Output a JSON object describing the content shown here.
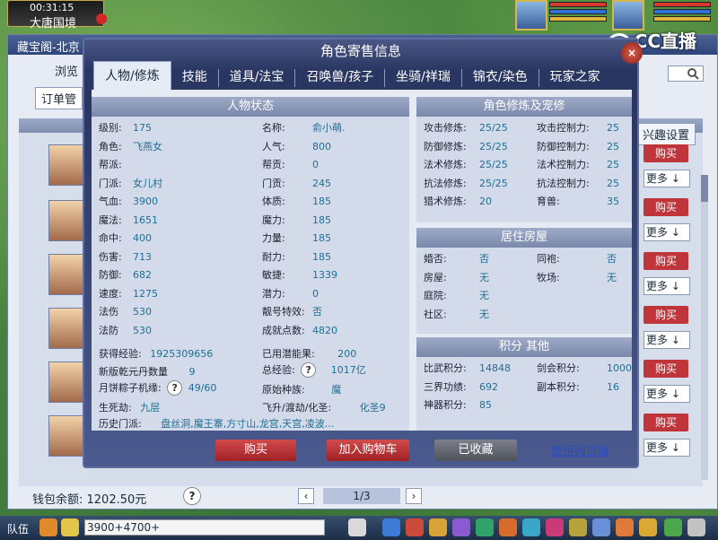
{
  "hud": {
    "game_time": "00:31:15",
    "map_name": "大唐国境"
  },
  "overlay": {
    "cc_logo": "CC直播"
  },
  "market": {
    "title": "藏宝阁-北京",
    "browse": "浏览",
    "order_btn": "订单管",
    "interest_btn": "兴趣设置",
    "buy_label": "购买",
    "more_label": "更多 ↓",
    "wallet": "钱包余额: 1202.50元",
    "page": "1/3"
  },
  "dialog": {
    "title": "角色寄售信息",
    "tabs": [
      "人物/修炼",
      "技能",
      "道具/法宝",
      "召唤兽/孩子",
      "坐骑/祥瑞",
      "锦衣/染色",
      "玩家之家"
    ],
    "sections": {
      "status": "人物状态",
      "cultivation": "角色修炼及宠修",
      "house": "居住房屋",
      "points": "积分 其他"
    },
    "col1": [
      [
        "级别:",
        "175"
      ],
      [
        "角色:",
        "飞燕女"
      ],
      [
        "帮派:",
        ""
      ],
      [
        "门派:",
        "女儿村"
      ],
      [
        "气血:",
        "3900"
      ],
      [
        "魔法:",
        "1651"
      ],
      [
        "命中:",
        "400"
      ],
      [
        "伤害:",
        "713"
      ],
      [
        "防御:",
        "682"
      ],
      [
        "速度:",
        "1275"
      ],
      [
        "法伤",
        "530"
      ],
      [
        "法防",
        "530"
      ]
    ],
    "col2": [
      [
        "名称:",
        "俞小萌."
      ],
      [
        "人气:",
        "800"
      ],
      [
        "帮贡:",
        "0"
      ],
      [
        "门贡:",
        "245"
      ],
      [
        "体质:",
        "185"
      ],
      [
        "魔力:",
        "185"
      ],
      [
        "力量:",
        "185"
      ],
      [
        "耐力:",
        "185"
      ],
      [
        "敏捷:",
        "1339"
      ],
      [
        "潜力:",
        "0"
      ],
      [
        "靓号特效:",
        "否"
      ],
      [
        "成就点数:",
        "4820"
      ]
    ],
    "extra": {
      "exp_label": "获得经验:",
      "exp_value": "1925309656",
      "potential_label": "已用潜能果:",
      "potential_value": "200",
      "dan_label": "新版乾元丹数量",
      "dan_value": "9",
      "total_exp_label": "总经验:",
      "total_exp_value": "1017亿",
      "mooncake_label": "月饼粽子机缘:",
      "mooncake_value": "49/60",
      "race_label": "原始种族:",
      "race_value": "魔",
      "life_label": "生死劫:",
      "life_value": "九层",
      "ascend_label": "飞升/渡劫/化圣:",
      "ascend_value": "化圣9",
      "history_label": "历史门派:",
      "history_value": "盘丝洞,魔王寨,方寸山,龙宫,天宫,凌波..."
    },
    "cultivation": [
      [
        "攻击修炼:",
        "25/25",
        "攻击控制力:",
        "25"
      ],
      [
        "防御修炼:",
        "25/25",
        "防御控制力:",
        "25"
      ],
      [
        "法术修炼:",
        "25/25",
        "法术控制力:",
        "25"
      ],
      [
        "抗法修炼:",
        "25/25",
        "抗法控制力:",
        "25"
      ],
      [
        "猎术修炼:",
        "20",
        "育兽:",
        "35"
      ]
    ],
    "house": [
      [
        "婚否:",
        "否",
        "同袍:",
        "否"
      ],
      [
        "房屋:",
        "无",
        "牧场:",
        "无"
      ],
      [
        "庭院:",
        "无",
        "",
        ""
      ],
      [
        "社区:",
        "无",
        "",
        ""
      ]
    ],
    "points": [
      [
        "比武积分:",
        "14848",
        "剑会积分:",
        "1000"
      ],
      [
        "三界功绩:",
        "692",
        "副本积分:",
        "16"
      ],
      [
        "神器积分:",
        "85",
        "",
        ""
      ]
    ],
    "buttons": {
      "buy": "购买",
      "cart": "加入购物车",
      "fav": "已收藏",
      "web": "使用网页版"
    }
  },
  "chat": {
    "team": "队伍",
    "input": "3900+4700+"
  }
}
